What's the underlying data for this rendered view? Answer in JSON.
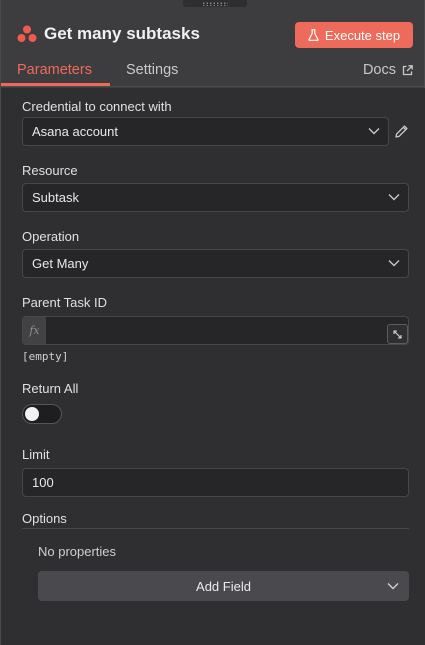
{
  "header": {
    "title": "Get many subtasks",
    "execute_label": "Execute step",
    "brand_color": "#ee6a5a"
  },
  "tabs": {
    "items": [
      {
        "label": "Parameters",
        "active": true
      },
      {
        "label": "Settings",
        "active": false
      }
    ],
    "docs_label": "Docs"
  },
  "fields": {
    "credential": {
      "label": "Credential to connect with",
      "value": "Asana account"
    },
    "resource": {
      "label": "Resource",
      "value": "Subtask"
    },
    "operation": {
      "label": "Operation",
      "value": "Get Many"
    },
    "parent_task_id": {
      "label": "Parent Task ID",
      "value": "",
      "expr_prefix": "fx",
      "hint": "[empty]"
    },
    "return_all": {
      "label": "Return All",
      "enabled": false
    },
    "limit": {
      "label": "Limit",
      "value": "100"
    }
  },
  "options": {
    "label": "Options",
    "empty_text": "No properties",
    "add_label": "Add Field"
  }
}
